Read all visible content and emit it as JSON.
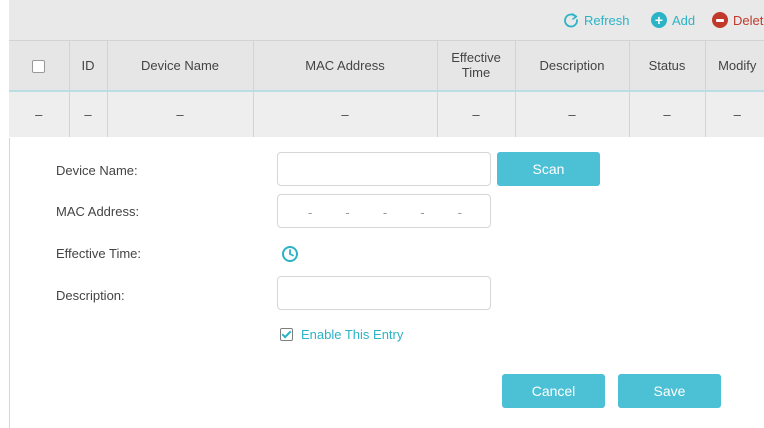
{
  "toolbar": {
    "refresh_label": "Refresh",
    "add_label": "Add",
    "delete_label": "Delete",
    "accent_color": "#2bb3c6",
    "delete_color": "#c0392b"
  },
  "table": {
    "headers": {
      "id": "ID",
      "device_name": "Device Name",
      "mac_address": "MAC Address",
      "effective_line1": "Effective",
      "effective_line2": "Time",
      "description": "Description",
      "status": "Status",
      "modify": "Modify"
    },
    "row": {
      "checkbox": "–",
      "id": "–",
      "device_name": "–",
      "mac_address": "–",
      "effective_time": "–",
      "description": "–",
      "status": "–",
      "modify": "–"
    }
  },
  "form": {
    "device_name_label": "Device Name:",
    "device_name_value": "",
    "mac_address_label": "MAC Address:",
    "mac_separator": "-",
    "effective_time_label": "Effective Time:",
    "description_label": "Description:",
    "description_value": "",
    "enable_label": "Enable This Entry",
    "enable_checked": true,
    "scan_label": "Scan",
    "cancel_label": "Cancel",
    "save_label": "Save",
    "button_color": "#4cc0d4"
  },
  "icons": {
    "refresh": "refresh-icon",
    "add": "plus-circle-icon",
    "delete": "minus-circle-icon",
    "clock": "clock-icon"
  }
}
